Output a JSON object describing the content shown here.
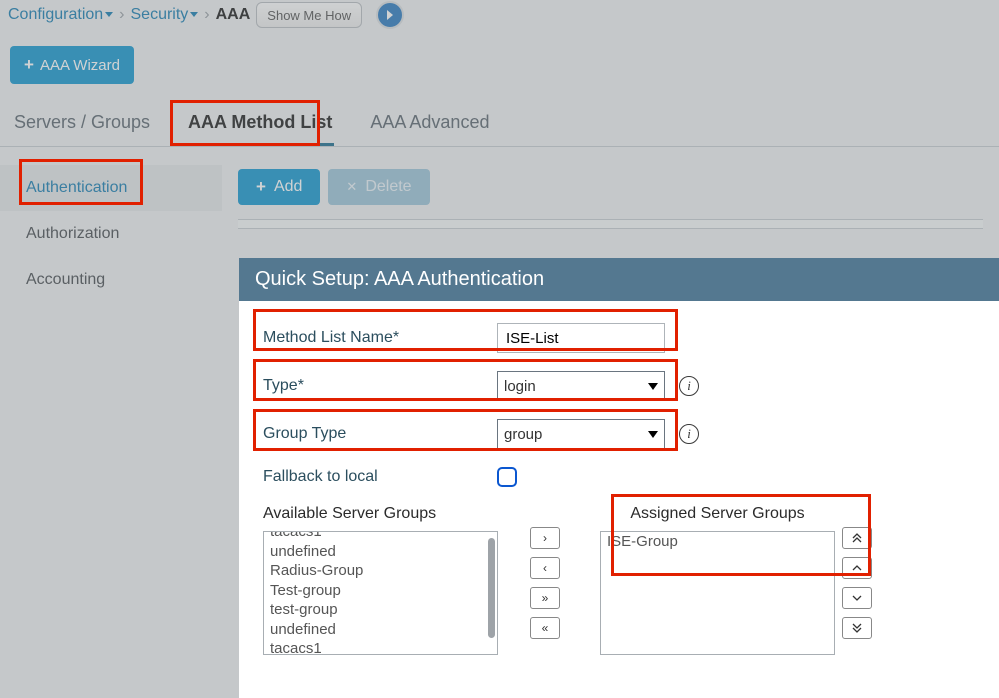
{
  "breadcrumb": {
    "configuration": "Configuration",
    "security": "Security",
    "aaa": "AAA",
    "show_me_how": "Show Me How"
  },
  "wizard_button": "AAA Wizard",
  "top_tabs": {
    "servers": "Servers / Groups",
    "method_list": "AAA Method List",
    "advanced": "AAA Advanced"
  },
  "side_tabs": {
    "authentication": "Authentication",
    "authorization": "Authorization",
    "accounting": "Accounting"
  },
  "toolbar": {
    "add": "Add",
    "delete": "Delete"
  },
  "modal": {
    "title": "Quick Setup: AAA Authentication",
    "labels": {
      "method_list_name": "Method List Name*",
      "type": "Type*",
      "group_type": "Group Type",
      "fallback": "Fallback to local",
      "available": "Available Server Groups",
      "assigned": "Assigned Server Groups"
    },
    "values": {
      "method_list_name": "ISE-List",
      "type": "login",
      "group_type": "group"
    },
    "available_groups": [
      "tacacs1",
      "undefined",
      "Radius-Group",
      "Test-group",
      "test-group",
      "undefined",
      "tacacs1"
    ],
    "assigned_groups": [
      "ISE-Group"
    ]
  },
  "shuttle": {
    "right": "›",
    "left": "‹",
    "all_right": "»",
    "all_left": "«"
  }
}
